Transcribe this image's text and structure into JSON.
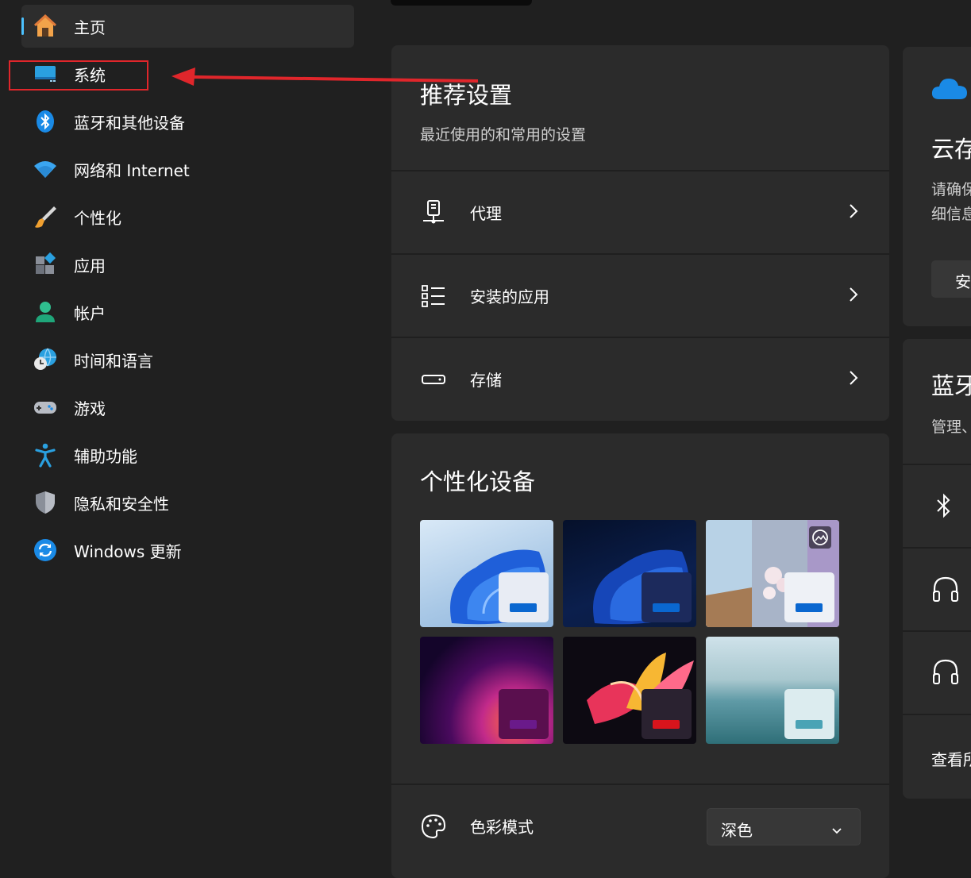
{
  "nav": {
    "items": [
      {
        "label": "主页",
        "icon": "home-icon",
        "selected": true
      },
      {
        "label": "系统",
        "icon": "system-display-icon"
      },
      {
        "label": "蓝牙和其他设备",
        "icon": "bluetooth-icon"
      },
      {
        "label": "网络和 Internet",
        "icon": "wifi-icon"
      },
      {
        "label": "个性化",
        "icon": "paintbrush-icon"
      },
      {
        "label": "应用",
        "icon": "apps-icon"
      },
      {
        "label": "帐户",
        "icon": "account-icon"
      },
      {
        "label": "时间和语言",
        "icon": "globe-clock-icon"
      },
      {
        "label": "游戏",
        "icon": "gamepad-icon"
      },
      {
        "label": "辅助功能",
        "icon": "accessibility-icon"
      },
      {
        "label": "隐私和安全性",
        "icon": "shield-icon"
      },
      {
        "label": "Windows 更新",
        "icon": "sync-icon"
      }
    ]
  },
  "annotation": {
    "color": "#e0262b",
    "target": "系统"
  },
  "recommended": {
    "title": "推荐设置",
    "subtitle": "最近使用的和常用的设置",
    "rows": [
      {
        "label": "代理",
        "icon": "proxy-icon"
      },
      {
        "label": "安装的应用",
        "icon": "list-icon"
      },
      {
        "label": "存储",
        "icon": "storage-icon"
      }
    ]
  },
  "personalize": {
    "title": "个性化设备",
    "themes": [
      "windows-light",
      "windows-dark",
      "glow",
      "captured-motion",
      "flow",
      "sunrise"
    ],
    "color_mode_label": "色彩模式",
    "color_mode_value": "深色"
  },
  "right": {
    "cloud_title": "云存",
    "cloud_text_1": "请确保",
    "cloud_text_2": "细信息",
    "cloud_button": "安",
    "bt_title": "蓝牙",
    "bt_sub": "管理、",
    "bt_device_icons": [
      "bluetooth-icon",
      "headphones-icon",
      "headphones-icon"
    ],
    "view_more": "查看所"
  },
  "colors": {
    "accent": "#4cc2ff",
    "background": "#202020",
    "card": "#2b2b2b"
  }
}
